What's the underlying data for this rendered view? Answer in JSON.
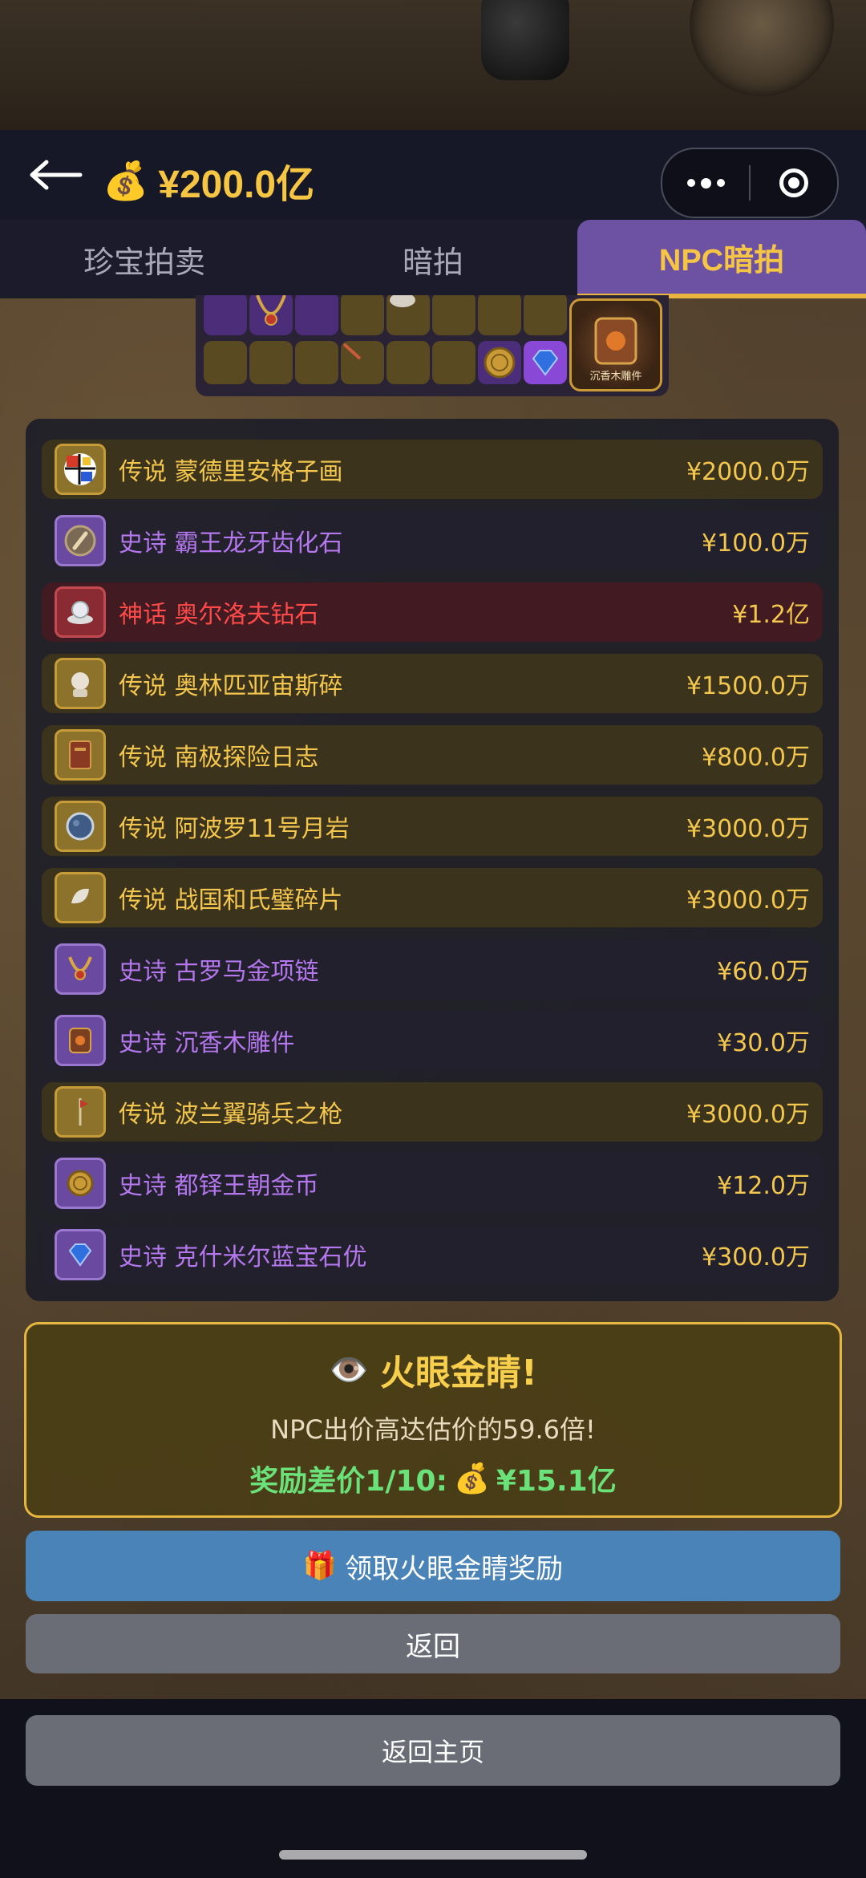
{
  "header": {
    "balance": "¥200.0亿",
    "money_icon": "💰"
  },
  "tabs": [
    {
      "label": "珍宝拍卖",
      "active": false
    },
    {
      "label": "暗拍",
      "active": false
    },
    {
      "label": "NPC暗拍",
      "active": true
    }
  ],
  "inventory": {
    "featured_label": "沉香木雕件"
  },
  "items": [
    {
      "rarity_name": "传说 蒙德里安格子画",
      "price": "¥2000.0万",
      "tier": "legend"
    },
    {
      "rarity_name": "史诗 霸王龙牙齿化石",
      "price": "¥100.0万",
      "tier": "epic"
    },
    {
      "rarity_name": "神话 奥尔洛夫钻石",
      "price": "¥1.2亿",
      "tier": "myth"
    },
    {
      "rarity_name": "传说 奥林匹亚宙斯碎",
      "price": "¥1500.0万",
      "tier": "legend"
    },
    {
      "rarity_name": "传说 南极探险日志",
      "price": "¥800.0万",
      "tier": "legend"
    },
    {
      "rarity_name": "传说 阿波罗11号月岩",
      "price": "¥3000.0万",
      "tier": "legend"
    },
    {
      "rarity_name": "传说 战国和氏璧碎片",
      "price": "¥3000.0万",
      "tier": "legend"
    },
    {
      "rarity_name": "史诗 古罗马金项链",
      "price": "¥60.0万",
      "tier": "epic"
    },
    {
      "rarity_name": "史诗 沉香木雕件",
      "price": "¥30.0万",
      "tier": "epic"
    },
    {
      "rarity_name": "传说 波兰翼骑兵之枪",
      "price": "¥3000.0万",
      "tier": "legend"
    },
    {
      "rarity_name": "史诗 都铎王朝金币",
      "price": "¥12.0万",
      "tier": "epic"
    },
    {
      "rarity_name": "史诗 克什米尔蓝宝石优",
      "price": "¥300.0万",
      "tier": "epic"
    }
  ],
  "reward": {
    "eye_icon": "👁️",
    "title": "火眼金睛!",
    "subtitle": "NPC出价高达估价的59.6倍!",
    "bonus_label": "奖励差价1/10:",
    "bonus_icon": "💰",
    "bonus_value": "¥15.1亿"
  },
  "buttons": {
    "claim_icon": "🎁",
    "claim": "领取火眼金睛奖励",
    "back": "返回",
    "home": "返回主页"
  },
  "colors": {
    "gold": "#f5c543",
    "epic": "#b477ee",
    "myth": "#ff4a4a",
    "bonus_green": "#6be17a",
    "claim_blue": "#4a83b8"
  }
}
